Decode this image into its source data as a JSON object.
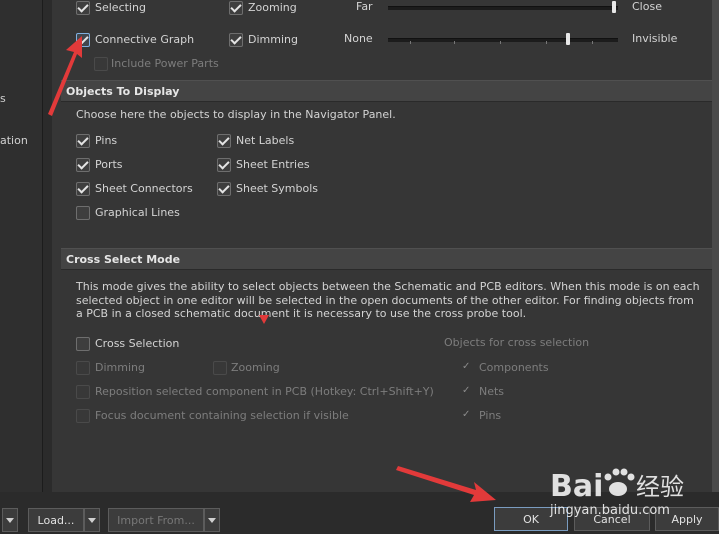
{
  "left_panel": {
    "label_1": "s",
    "label_2": "ation"
  },
  "top": {
    "selecting": "Selecting",
    "zooming": "Zooming",
    "connective_graph": "Connective Graph",
    "dimming": "Dimming",
    "include_power_parts": "Include Power Parts",
    "zoom_slider": {
      "min_label": "Far",
      "max_label": "Close",
      "value": 0.99
    },
    "dim_slider": {
      "min_label": "None",
      "max_label": "Invisible",
      "value": 0.78
    }
  },
  "objects_to_display": {
    "title": "Objects To Display",
    "description": "Choose here the objects to display in the Navigator Panel.",
    "items": [
      {
        "label": "Pins",
        "checked": true
      },
      {
        "label": "Net Labels",
        "checked": true
      },
      {
        "label": "Ports",
        "checked": true
      },
      {
        "label": "Sheet Entries",
        "checked": true
      },
      {
        "label": "Sheet Connectors",
        "checked": true
      },
      {
        "label": "Sheet Symbols",
        "checked": true
      },
      {
        "label": "Graphical Lines",
        "checked": false
      }
    ]
  },
  "cross_select_mode": {
    "title": "Cross Select Mode",
    "description_lines": [
      "This mode gives the ability to select objects between the Schematic and PCB editors.  When this mode is on each",
      "selected object in one editor will be selected in the open documents of the other editor.  For finding objects from",
      "a PCB in a closed schematic document it is necessary to use the cross probe tool."
    ],
    "cross_selection": "Cross Selection",
    "dimming": "Dimming",
    "zooming": "Zooming",
    "reposition": "Reposition selected component in PCB (Hotkey: Ctrl+Shift+Y)",
    "focus": "Focus document containing selection if visible",
    "objects_header": "Objects for cross selection",
    "objects": [
      "Components",
      "Nets",
      "Pins"
    ]
  },
  "buttons": {
    "load": "Load...",
    "import_from": "Import From...",
    "ok": "OK",
    "cancel": "Cancel",
    "apply": "Apply"
  },
  "watermark": {
    "brand": "Bai",
    "brand_cn": "经验",
    "url": "jingyan.baidu.com"
  },
  "colors": {
    "accent_arrow": "#e23a3a",
    "panel_bg": "#363636",
    "header_bg": "#444444"
  }
}
